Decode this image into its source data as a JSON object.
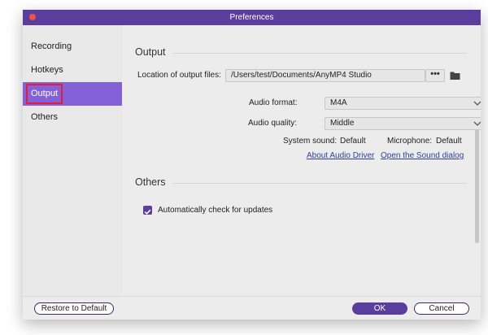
{
  "window": {
    "title": "Preferences"
  },
  "sidebar": {
    "items": [
      {
        "label": "Recording"
      },
      {
        "label": "Hotkeys"
      },
      {
        "label": "Output"
      },
      {
        "label": "Others"
      }
    ],
    "active_index": 2
  },
  "output": {
    "heading": "Output",
    "location_label": "Location of output files:",
    "location_value": "/Users/test/Documents/AnyMP4 Studio",
    "browse_glyph": "•••",
    "folder_icon": "folder-icon",
    "audio_format_label": "Audio format:",
    "audio_format_value": "M4A",
    "audio_quality_label": "Audio quality:",
    "audio_quality_value": "Middle",
    "system_sound_label": "System sound:",
    "system_sound_value": "Default",
    "microphone_label": "Microphone:",
    "microphone_value": "Default",
    "about_audio_driver_link": "About Audio Driver",
    "open_sound_dialog_link": "Open the Sound dialog"
  },
  "others": {
    "heading": "Others",
    "auto_update_label": "Automatically check for updates",
    "auto_update_checked": true
  },
  "footer": {
    "restore_label": "Restore to Default",
    "ok_label": "OK",
    "cancel_label": "Cancel"
  },
  "colors": {
    "titlebar": "#5b3d9e",
    "sidebar_active": "#8461d6",
    "link": "#2c3fa0",
    "highlight_box": "#e11d3a"
  }
}
